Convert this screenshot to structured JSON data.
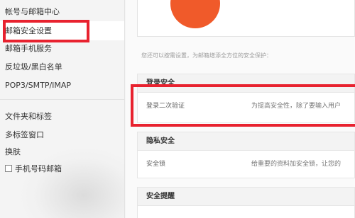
{
  "sidebar": {
    "items": [
      {
        "label": "帐号与邮箱中心"
      },
      {
        "label": "邮箱安全设置"
      },
      {
        "label": "邮箱手机服务"
      },
      {
        "label": "反垃圾/黑白名单"
      },
      {
        "label": "POP3/SMTP/IMAP"
      },
      {
        "label": "文件夹和标签"
      },
      {
        "label": "多标签窗口"
      },
      {
        "label": "换肤"
      },
      {
        "label": "手机号码邮箱"
      }
    ]
  },
  "main": {
    "intro": "您还可以按需设置，为邮箱增添全方位的安全保护：",
    "sections": [
      {
        "title": "登录安全",
        "row_label": "登录二次验证",
        "row_desc": "为提高安全性，除了要输入用户"
      },
      {
        "title": "隐私安全",
        "row_label": "安全锁",
        "row_desc": "给重要的资料加安全锁，让您的"
      },
      {
        "title": "安全提醒"
      }
    ]
  },
  "colors": {
    "highlight": "#e8222f",
    "accent_circle": "#f05a2a"
  }
}
